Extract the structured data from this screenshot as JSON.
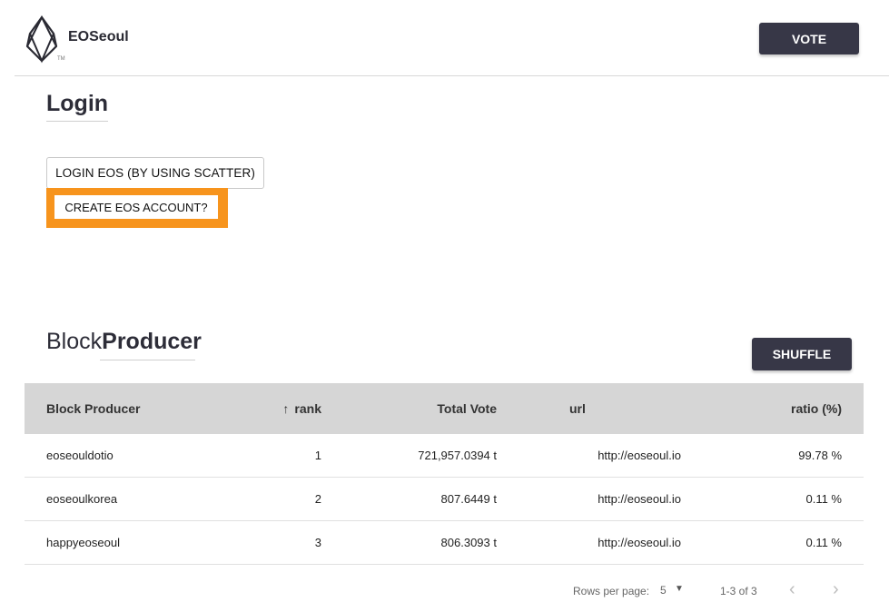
{
  "header": {
    "brand": "EOSeoul",
    "trademark": "TM",
    "vote_label": "VOTE"
  },
  "login": {
    "title": "Login",
    "scatter_label": "LOGIN EOS (BY USING SCATTER)",
    "create_label": "CREATE EOS ACCOUNT?",
    "highlight_color": "#f7941d"
  },
  "block_producer": {
    "title_light": "Block",
    "title_bold": "Producer",
    "shuffle_label": "SHUFFLE",
    "columns": {
      "name": "Block Producer",
      "rank": "rank",
      "vote": "Total Vote",
      "url": "url",
      "ratio": "ratio (%)"
    },
    "rows": [
      {
        "name": "eoseouldotio",
        "rank": "1",
        "vote": "721,957.0394 t",
        "url": "http://eoseoul.io",
        "ratio": "99.78 %"
      },
      {
        "name": "eoseoulkorea",
        "rank": "2",
        "vote": "807.6449 t",
        "url": "http://eoseoul.io",
        "ratio": "0.11 %"
      },
      {
        "name": "happyeoseoul",
        "rank": "3",
        "vote": "806.3093 t",
        "url": "http://eoseoul.io",
        "ratio": "0.11 %"
      }
    ],
    "pagination": {
      "rows_per_page_label": "Rows per page:",
      "rows_per_page_value": "5",
      "range": "1-3 of 3"
    }
  },
  "colors": {
    "dark_button": "#373747",
    "table_header": "#d6d6d6"
  }
}
